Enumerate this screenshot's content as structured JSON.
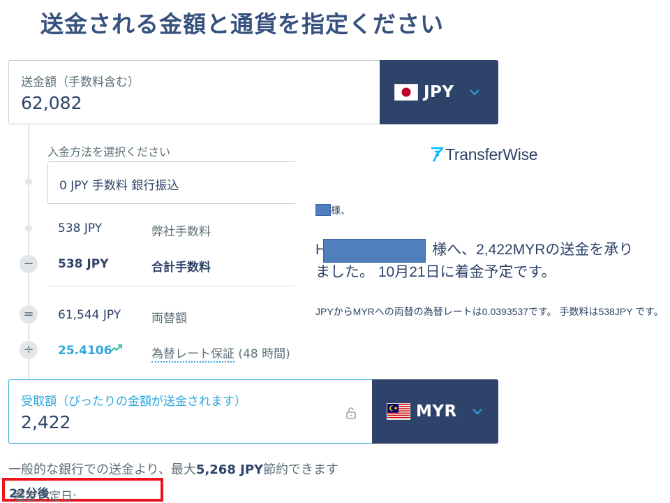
{
  "page_title": "送金される金額と通貨を指定ください",
  "send": {
    "label": "送金額（手数料含む）",
    "value": "62,082",
    "currency": "JPY",
    "flag": "japan-flag"
  },
  "payment": {
    "label": "入金方法を選択ください",
    "selected": "0 JPY 手数料  銀行振込"
  },
  "fees": {
    "our_fee_amount": "538 JPY",
    "our_fee_label": "弊社手数料",
    "total_fee_amount": "538 JPY",
    "total_fee_label": "合計手数料"
  },
  "conversion": {
    "converted_amount": "61,544 JPY",
    "converted_label": "両替額",
    "rate": "25.4106",
    "rate_label": "為替レート保証",
    "rate_hours": " (48 時間)"
  },
  "receive": {
    "label": "受取額（ぴったりの金額が送金されます）",
    "value": "2,422",
    "currency": "MYR",
    "flag": "malaysia-flag"
  },
  "savings": {
    "prefix": "一般的な銀行での送金より、最大",
    "amount": "5,268 JPY",
    "suffix": "節約できます"
  },
  "arrival": {
    "label": "着金予定日:",
    "value": "22分後"
  },
  "email": {
    "brand": "TransferWise",
    "greeting": "様、",
    "message_line1": "様へ、2,422MYRの送金を承り",
    "message_line1_prefix": "H",
    "message_line2": "ました。 10月21日に着金予定です。",
    "rate_note": "JPYからMYRへの両替の為替レートは0.0393537です。 手数料は538JPY です。"
  },
  "colors": {
    "brand_navy": "#2e4369",
    "accent_blue": "#2ea5dd",
    "highlight_red": "#e8131b",
    "redaction": "#4f7fbd"
  }
}
